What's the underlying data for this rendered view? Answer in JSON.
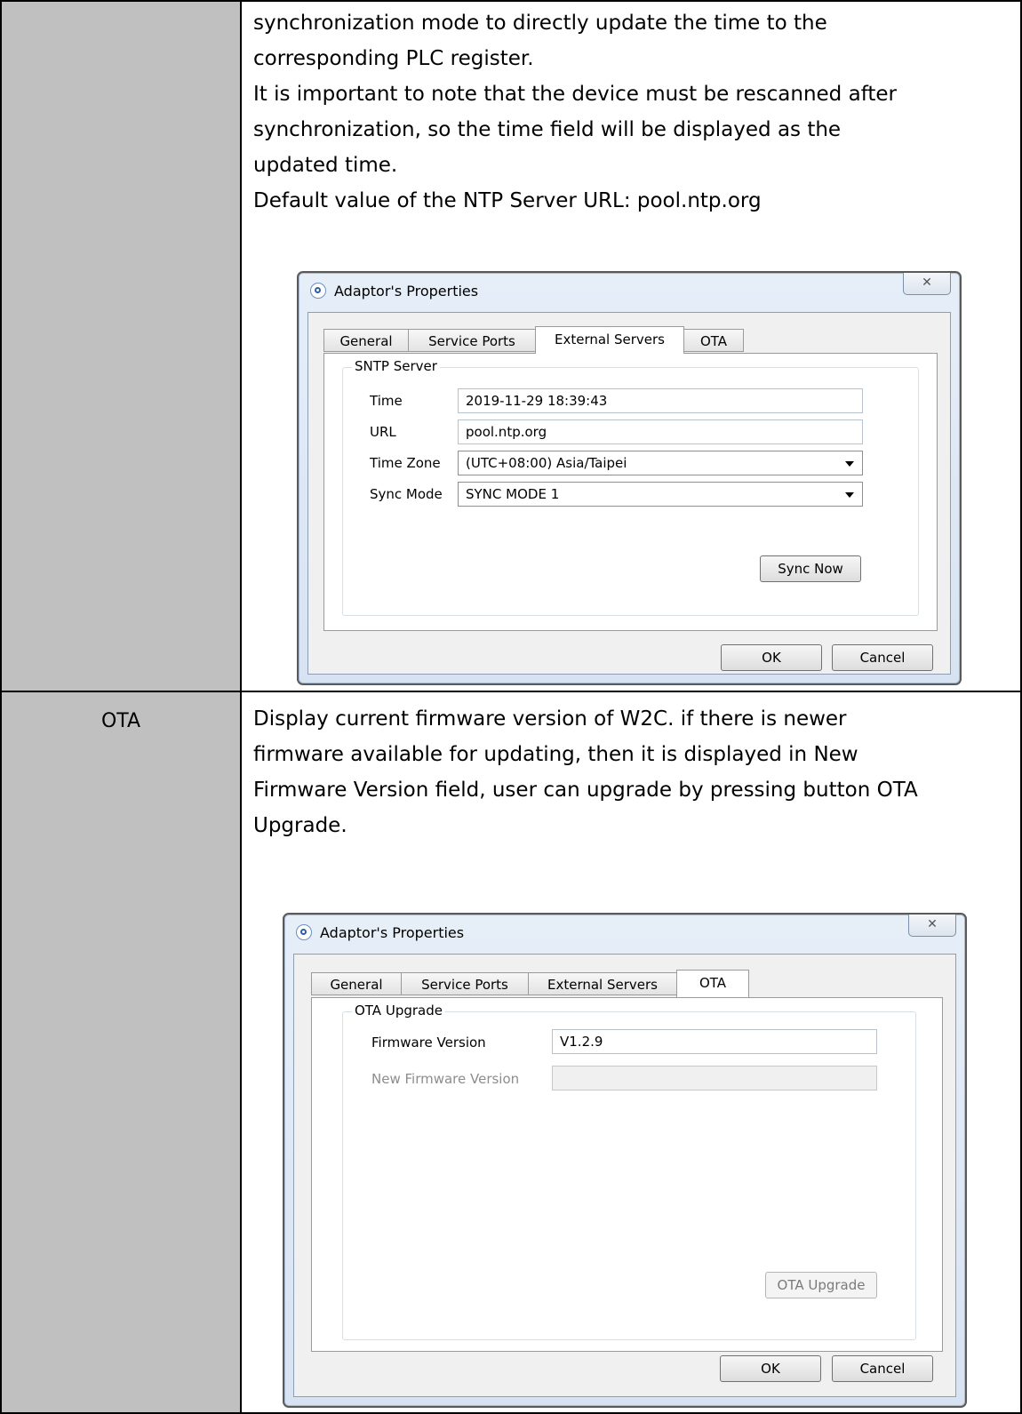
{
  "rows": [
    {
      "label": "",
      "paragraphs": [
        "synchronization mode to directly update the time to the",
        "corresponding PLC register.",
        "It is important to note that the device must be rescanned after",
        "synchronization, so the time field will be displayed as the",
        "updated time.",
        "Default value of the NTP Server URL: pool.ntp.org"
      ]
    },
    {
      "label": "OTA",
      "paragraphs": [
        "Display current firmware version of W2C. if there is newer",
        "firmware available for updating, then it is displayed in New",
        "Firmware Version field, user can upgrade by pressing button OTA",
        "Upgrade."
      ]
    }
  ],
  "dialog_common": {
    "title": "Adaptor's Properties",
    "close_glyph": "✕",
    "tabs": [
      "General",
      "Service Ports",
      "External Servers",
      "OTA"
    ],
    "ok_label": "OK",
    "cancel_label": "Cancel"
  },
  "dialog_sntp": {
    "active_tab": "External Servers",
    "group_title": "SNTP Server",
    "time_label": "Time",
    "time_value": "2019-11-29 18:39:43",
    "url_label": "URL",
    "url_value": "pool.ntp.org",
    "timezone_label": "Time Zone",
    "timezone_value": "(UTC+08:00) Asia/Taipei",
    "syncmode_label": "Sync Mode",
    "syncmode_value": "SYNC MODE 1",
    "sync_now_label": "Sync Now"
  },
  "dialog_ota": {
    "active_tab": "OTA",
    "group_title": "OTA Upgrade",
    "firmware_label": "Firmware Version",
    "firmware_value": "V1.2.9",
    "new_firmware_label": "New Firmware Version",
    "new_firmware_value": "",
    "ota_upgrade_label": "OTA Upgrade"
  }
}
